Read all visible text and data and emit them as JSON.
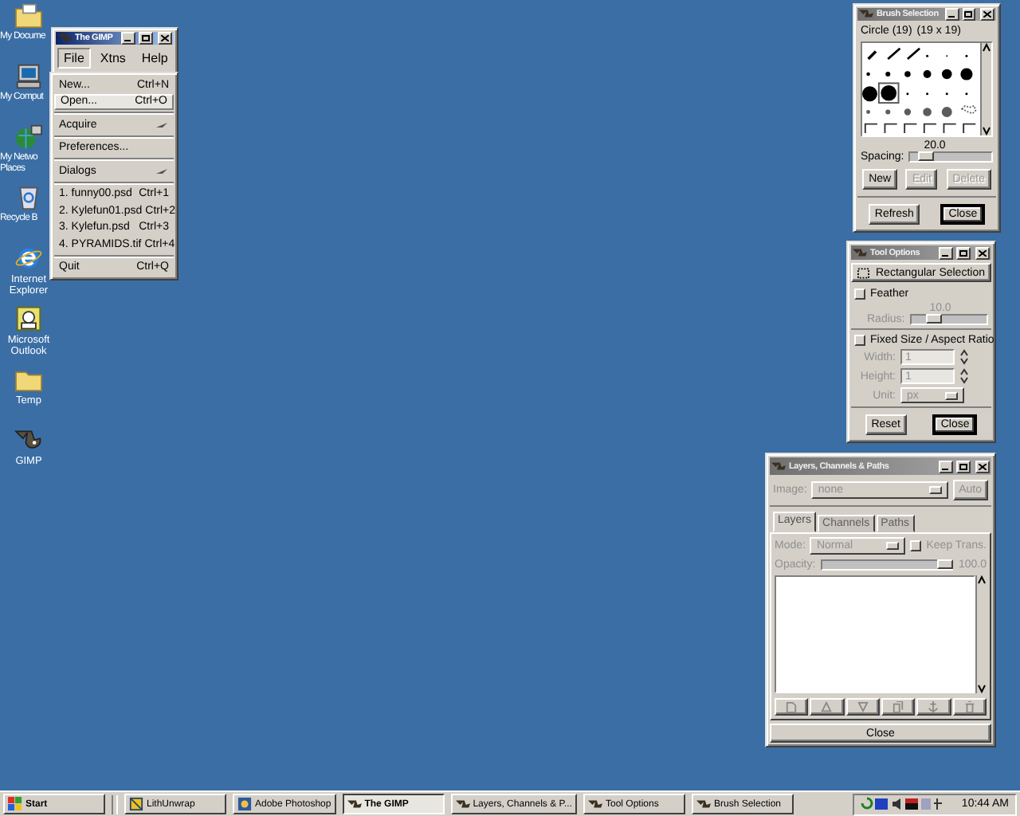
{
  "desktop_icons": [
    {
      "kind": "documents",
      "label": "My Docume"
    },
    {
      "kind": "computer",
      "label": "My Comput"
    },
    {
      "kind": "network",
      "label": "My Netwo\nPlaces"
    },
    {
      "kind": "recycle",
      "label": "Recycle B"
    },
    {
      "kind": "browser",
      "label": "Internet\nExplorer"
    },
    {
      "kind": "mail",
      "label": "Microsoft\nOutlook"
    },
    {
      "kind": "folder",
      "label": "Temp"
    },
    {
      "kind": "gimp",
      "label": "GIMP"
    }
  ],
  "gimp_window": {
    "title": "The GIMP",
    "active": true,
    "menus": [
      {
        "label": "File",
        "selected": true
      },
      {
        "label": "Xtns",
        "selected": false
      },
      {
        "label": "Help",
        "selected": false
      }
    ]
  },
  "file_menu": {
    "items": [
      {
        "kind": "item",
        "label": "New...",
        "shortcut": "Ctrl+N",
        "selected": false
      },
      {
        "kind": "item",
        "label": "Open...",
        "shortcut": "Ctrl+O",
        "selected": true
      },
      {
        "kind": "separator"
      },
      {
        "kind": "submenu",
        "label": "Acquire",
        "selected": false
      },
      {
        "kind": "separator"
      },
      {
        "kind": "item",
        "label": "Preferences...",
        "selected": false
      },
      {
        "kind": "separator"
      },
      {
        "kind": "submenu",
        "label": "Dialogs",
        "selected": false
      },
      {
        "kind": "separator"
      },
      {
        "kind": "item",
        "label": "1. funny00.psd",
        "shortcut": "Ctrl+1",
        "selected": false
      },
      {
        "kind": "item",
        "label": "2. Kylefun01.psd",
        "shortcut": "Ctrl+2",
        "selected": false
      },
      {
        "kind": "item",
        "label": "3. Kylefun.psd",
        "shortcut": "Ctrl+3",
        "selected": false
      },
      {
        "kind": "item",
        "label": "4. PYRAMIDS.tif",
        "shortcut": "Ctrl+4",
        "selected": false
      },
      {
        "kind": "separator"
      },
      {
        "kind": "item",
        "label": "Quit",
        "shortcut": "Ctrl+Q",
        "selected": false
      }
    ]
  },
  "brush_selection": {
    "title": "Brush Selection",
    "active": false,
    "brush_name": "Circle (19)",
    "brush_size": "(19 x 19)",
    "spacing": {
      "label": "Spacing:",
      "reading": "20.0",
      "level": 0.2
    },
    "buttons": [
      {
        "label": "New",
        "disabled": false
      },
      {
        "label": "Edit",
        "disabled": true
      },
      {
        "label": "Delete",
        "disabled": true
      }
    ],
    "footer_buttons": [
      {
        "label": "Refresh",
        "default": false
      },
      {
        "label": "Close",
        "default": true
      }
    ]
  },
  "tool_options": {
    "title": "Tool Options",
    "active": false,
    "tool": "Rectangular Selection",
    "feather": {
      "label": "Feather",
      "checked": false
    },
    "radius": {
      "label": "Radius:",
      "reading": "10.0",
      "level": 0.3,
      "disabled": true
    },
    "fixed": {
      "label": "Fixed Size / Aspect Ratio",
      "checked": false
    },
    "fields": [
      {
        "label": "Width:",
        "value": "1",
        "disabled": true
      },
      {
        "label": "Height:",
        "value": "1",
        "disabled": true
      }
    ],
    "unit": {
      "label": "Unit:",
      "value": "px",
      "disabled": true
    },
    "footer_buttons": [
      {
        "label": "Reset",
        "default": false
      },
      {
        "label": "Close",
        "default": true
      }
    ]
  },
  "layers": {
    "title": "Layers, Channels & Paths",
    "active": false,
    "image": {
      "label": "Image:",
      "value": "none"
    },
    "auto_button": "Auto",
    "tabs": [
      {
        "label": "Layers",
        "selected": true
      },
      {
        "label": "Channels",
        "selected": false
      },
      {
        "label": "Paths",
        "selected": false
      }
    ],
    "mode": {
      "label": "Mode:",
      "value": "Normal"
    },
    "keep_trans": {
      "label": "Keep Trans.",
      "checked": false
    },
    "opacity": {
      "label": "Opacity:",
      "reading": "100.0",
      "level": 1
    },
    "close_button": "Close"
  },
  "taskbar": {
    "start": "Start",
    "tasks": [
      {
        "kind": "lith",
        "label": "LithUnwrap",
        "selected": false
      },
      {
        "kind": "photoshop",
        "label": "Adobe Photoshop",
        "selected": false
      },
      {
        "kind": "gimp",
        "label": "The GIMP",
        "selected": true
      },
      {
        "kind": "gimp",
        "label": "Layers, Channels & P...",
        "selected": false
      },
      {
        "kind": "gimp",
        "label": "Tool Options",
        "selected": false
      },
      {
        "kind": "gimp",
        "label": "Brush Selection",
        "selected": false
      }
    ],
    "clock": "10:44 AM"
  }
}
